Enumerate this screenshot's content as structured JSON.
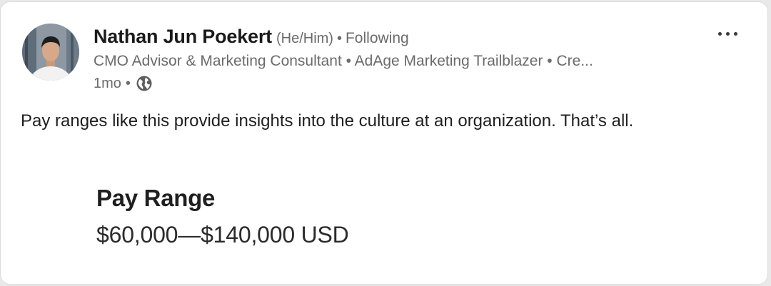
{
  "post": {
    "author": {
      "name": "Nathan Jun Poekert",
      "pronouns": "(He/Him)",
      "follow_status": "Following",
      "headline": "CMO Advisor & Marketing Consultant • AdAge Marketing Trailblazer • Cre...",
      "avatar_icon": "profile-photo"
    },
    "meta": {
      "time": "1mo",
      "separator": "•",
      "visibility_icon": "globe-icon"
    },
    "menu_icon": "more-options-icon",
    "body": "Pay ranges like this provide insights into the culture at an organization. That’s all.",
    "image": {
      "title": "Pay Range",
      "value": "$60,000—$140,000 USD"
    }
  }
}
